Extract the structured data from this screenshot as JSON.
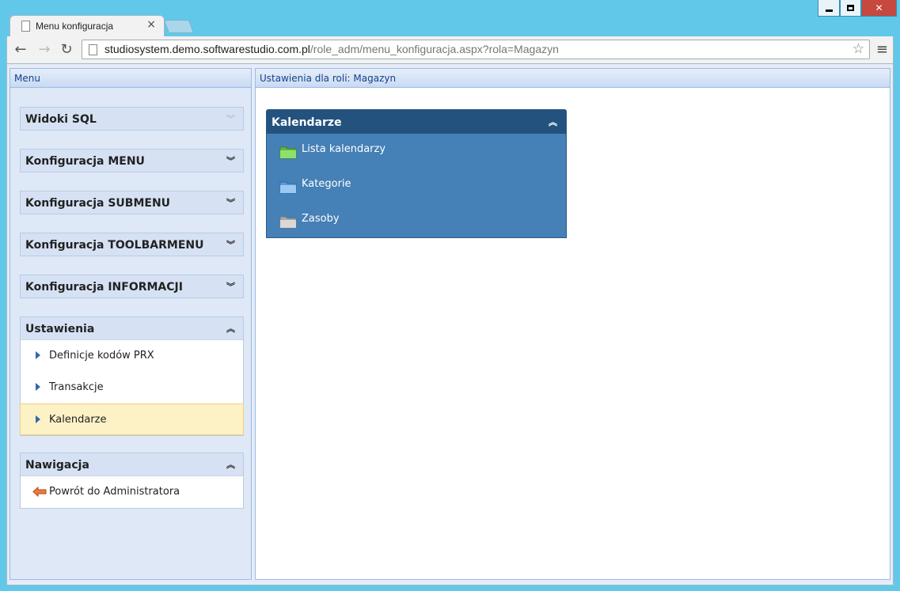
{
  "browser": {
    "tab_title": "Menu konfiguracja",
    "url_host": "studiosystem.demo.softwarestudio.com.pl",
    "url_path": "/role_adm/menu_konfiguracja.aspx?rola=Magazyn"
  },
  "left_panel": {
    "title": "Menu",
    "sections": [
      {
        "title": "Widoki SQL"
      },
      {
        "title": "Konfiguracja MENU"
      },
      {
        "title": "Konfiguracja SUBMENU"
      },
      {
        "title": "Konfiguracja TOOLBARMENU"
      },
      {
        "title": "Konfiguracja INFORMACJI"
      },
      {
        "title": "Ustawienia",
        "items": [
          "Definicje kodów PRX",
          "Transakcje",
          "Kalendarze"
        ]
      },
      {
        "title": "Nawigacja",
        "items": [
          "Powrót do Administratora"
        ]
      }
    ]
  },
  "right_panel": {
    "title": "Ustawienia dla roli: Magazyn",
    "box": {
      "title": "Kalendarze",
      "items": [
        "Lista kalendarzy",
        "Kategorie",
        "Zasoby"
      ]
    }
  },
  "colors": {
    "folder_green": "#7fd35a",
    "folder_blue": "#8fc0ee",
    "folder_gray": "#c8c8c8"
  }
}
